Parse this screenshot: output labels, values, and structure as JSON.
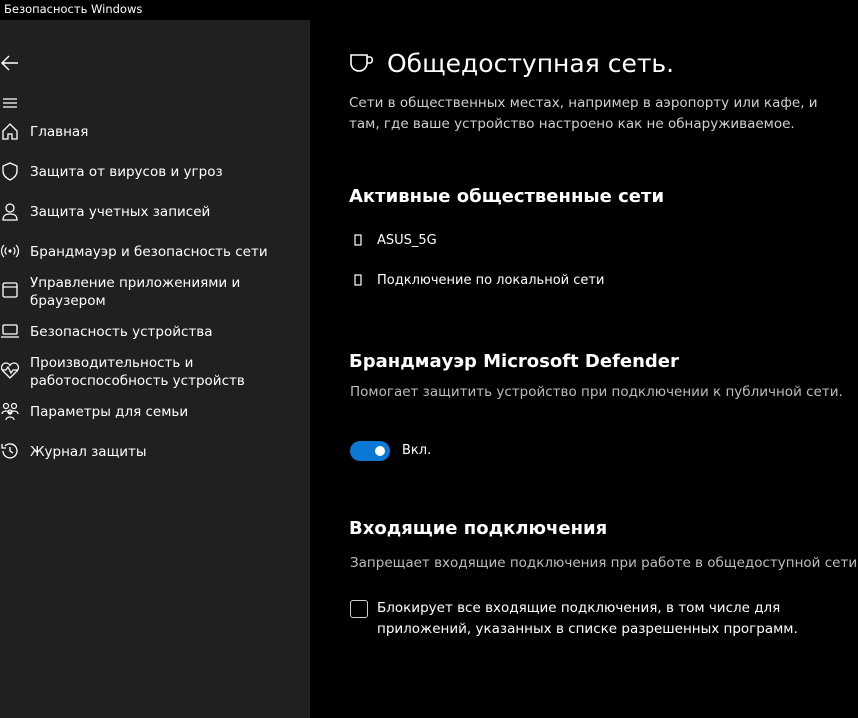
{
  "window": {
    "title": "Безопасность Windows"
  },
  "sidebar": {
    "back_icon": "back-arrow-icon",
    "menu_icon": "hamburger-menu-icon",
    "items": [
      {
        "label": "Главная",
        "icon": "home-icon"
      },
      {
        "label": "Защита от вирусов и угроз",
        "icon": "shield-icon"
      },
      {
        "label": "Защита учетных записей",
        "icon": "person-icon"
      },
      {
        "label": "Брандмауэр и безопасность сети",
        "icon": "wireless-antenna-icon"
      },
      {
        "label": "Управление приложениями и браузером",
        "icon": "app-window-icon"
      },
      {
        "label": "Безопасность устройства",
        "icon": "laptop-icon"
      },
      {
        "label": "Производительность и работоспособность устройств",
        "icon": "heart-pulse-icon"
      },
      {
        "label": "Параметры для семьи",
        "icon": "family-icon"
      },
      {
        "label": "Журнал защиты",
        "icon": "history-icon"
      }
    ]
  },
  "main": {
    "header_icon": "coffee-cup-icon",
    "title": "Общедоступная сеть.",
    "description": "Сети в общественных местах, например в аэропорту или кафе, и там, где ваше устройство настроено как не обнаруживаемое.",
    "active_networks": {
      "title": "Активные общественные сети",
      "networks": [
        {
          "label": "ASUS_5G",
          "icon": "network-device-icon"
        },
        {
          "label": "Подключение по локальной сети",
          "icon": "network-device-icon"
        }
      ]
    },
    "firewall": {
      "title": "Брандмауэр Microsoft Defender",
      "description": "Помогает защитить устройство при подключении к публичной сети.",
      "toggle_state": "on",
      "toggle_label": "Вкл.",
      "toggle_color": "#0a78d4"
    },
    "incoming": {
      "title": "Входящие подключения",
      "description": "Запрещает входящие подключения при работе в общедоступной сети.",
      "checkbox_checked": false,
      "checkbox_label": "Блокирует все входящие подключения, в том числе для приложений, указанных в списке разрешенных программ."
    }
  },
  "colors": {
    "sidebar_bg": "#202020",
    "main_bg": "#000000",
    "accent": "#0a78d4"
  }
}
